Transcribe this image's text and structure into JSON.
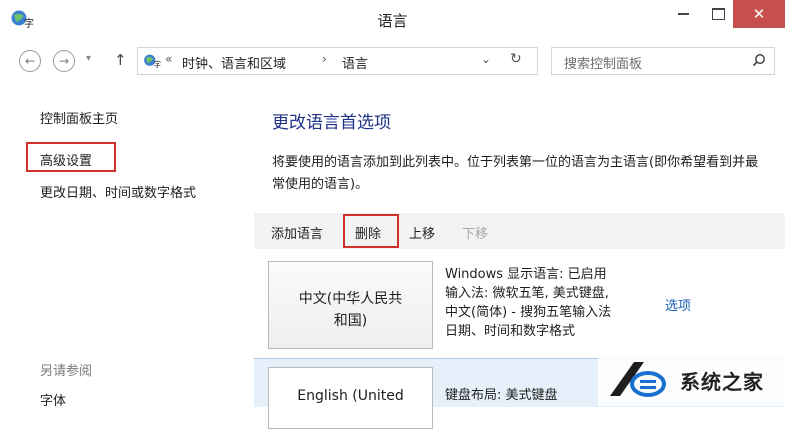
{
  "window": {
    "title": "语言",
    "minimize_label": "",
    "close_label": "✕"
  },
  "address": {
    "overflow": "«",
    "crumbs": [
      "时钟、语言和区域",
      "语言"
    ],
    "separator": "›",
    "dropdown": "⌄",
    "refresh": "↻"
  },
  "search": {
    "placeholder": "搜索控制面板"
  },
  "sidebar": {
    "home": "控制面板主页",
    "advanced": "高级设置",
    "datetime": "更改日期、时间或数字格式",
    "see_also": "另请参阅",
    "fonts": "字体"
  },
  "main": {
    "heading": "更改语言首选项",
    "description": "将要使用的语言添加到此列表中。位于列表第一位的语言为主语言(即你希望看到并最常使用的语言)。"
  },
  "toolbar": {
    "add": "添加语言",
    "remove": "删除",
    "up": "上移",
    "down": "下移"
  },
  "languages": [
    {
      "name_line1": "中文(中华人民共",
      "name_line2": "和国)",
      "details": [
        "Windows 显示语言: 已启用",
        "输入法: 微软五笔, 美式键盘,",
        "中文(简体) - 搜狗五笔输入法",
        "日期、时间和数字格式"
      ],
      "options": "选项"
    },
    {
      "name_line1": "English (United",
      "details": [
        "键盘布局: 美式键盘"
      ]
    }
  ],
  "watermark": {
    "text": "系统之家"
  },
  "colors": {
    "highlight_red": "#d0302a",
    "heading_blue": "#1e3287",
    "link_blue": "#1a5fb4",
    "close_red": "#c7504e",
    "selected_row": "#e6f0fa"
  }
}
